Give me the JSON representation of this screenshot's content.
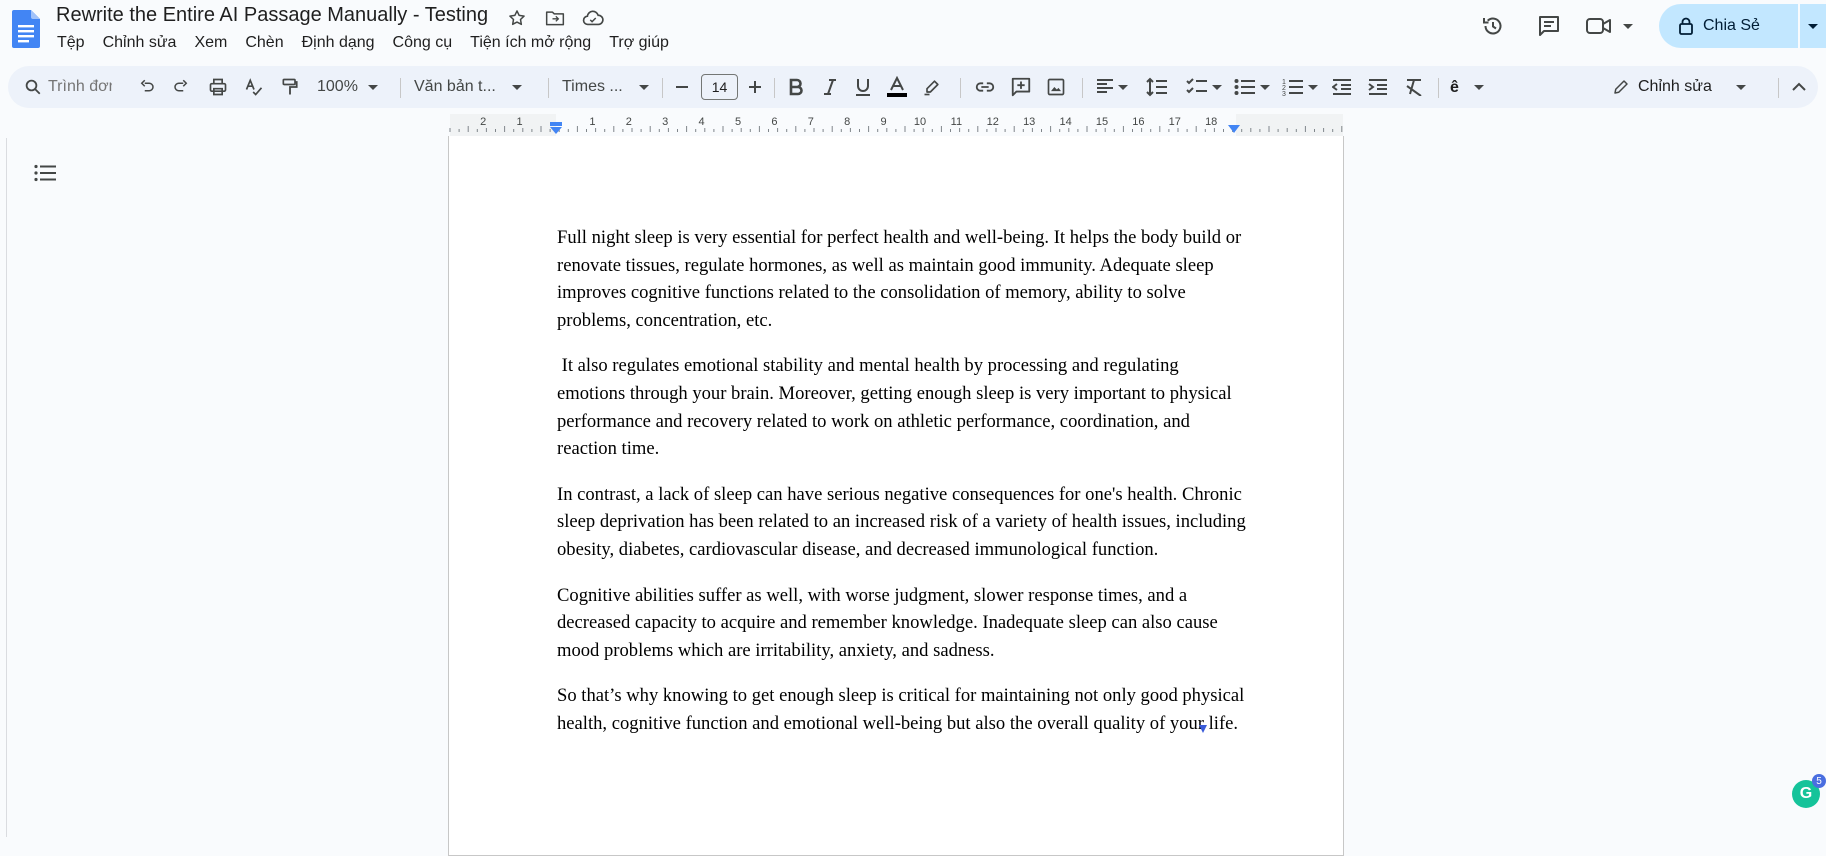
{
  "header": {
    "title": "Rewrite the Entire AI Passage Manually - Testing",
    "share_label": "Chia Sẻ",
    "icons": [
      "docs-logo",
      "star-icon",
      "move-folder-icon",
      "cloud-status-icon",
      "history-icon",
      "comment-icon",
      "video-call-icon"
    ]
  },
  "menu": {
    "items": [
      "Tệp",
      "Chỉnh sửa",
      "Xem",
      "Chèn",
      "Định dạng",
      "Công cụ",
      "Tiện ích mở rộng",
      "Trợ giúp"
    ]
  },
  "toolbar": {
    "search_placeholder": "Trình đơn",
    "zoom": "100%",
    "style": "Văn bản t...",
    "font": "Times ...",
    "font_size": "14",
    "mode_label": "Chỉnh sửa"
  },
  "ruler": {
    "labels": [
      "2",
      "1",
      "1",
      "2",
      "3",
      "4",
      "5",
      "6",
      "7",
      "8",
      "9",
      "10",
      "11",
      "12",
      "13",
      "14",
      "15",
      "16",
      "17",
      "18"
    ]
  },
  "document": {
    "paragraphs": [
      "Full night sleep is very essential for perfect health and well-being. It helps the body build or renovate tissues, regulate hormones, as well as maintain good immunity. Adequate sleep improves cognitive functions related to the consolidation of memory, ability to solve problems, concentration, etc.",
      " It also regulates emotional stability and mental health by processing and regulating emotions through your brain. Moreover, getting enough sleep is very important to physical performance and recovery related to work on athletic performance, coordination, and reaction time.",
      "In contrast, a lack of sleep can have serious negative consequences for one's health. Chronic sleep deprivation has been related to an increased risk of a variety of health issues, including obesity, diabetes, cardiovascular disease, and decreased immunological function.",
      "Cognitive abilities suffer as well, with worse judgment, slower response times, and a decreased capacity to acquire and remember knowledge. Inadequate sleep can also cause mood problems which are irritability, anxiety, and sadness.",
      "So that’s why knowing to get enough sleep is critical for maintaining not only good physical health, cognitive function and emotional well-being but also the overall quality of your life."
    ]
  },
  "grammarly": {
    "label": "G",
    "badge_count": "5"
  },
  "colors": {
    "accent": "#c2e7ff",
    "toolbar_bg": "#edf2fa",
    "docs_blue": "#4285f4",
    "grammarly": "#15c39a"
  }
}
